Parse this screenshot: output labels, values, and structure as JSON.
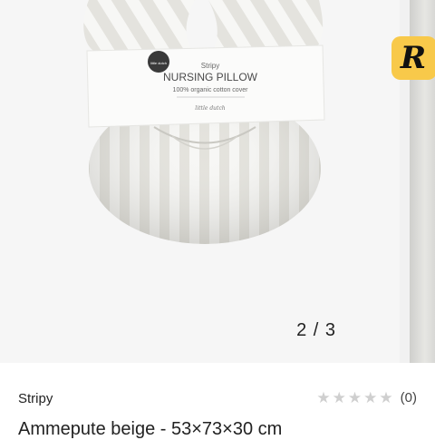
{
  "gallery": {
    "current": "2",
    "separator": "/",
    "total": "3",
    "counter_text": "2 / 3",
    "image": {
      "subject": "nursing-pillow",
      "label_brand": "Stripy",
      "label_title": "NURSING PILLOW",
      "label_subtitle": "100% organic cotton cover",
      "label_signature": "little dutch"
    }
  },
  "app_badge": {
    "letter": "R",
    "color": "#f8c94a"
  },
  "product": {
    "brand": "Stripy",
    "title": "Ammepute beige - 53×73×30 cm",
    "rating": {
      "stars_filled": 0,
      "stars_total": 5,
      "count_text": "(0)"
    }
  },
  "colors": {
    "star_empty": "#cfcfcf",
    "gallery_bg": "#f6f6f6"
  }
}
